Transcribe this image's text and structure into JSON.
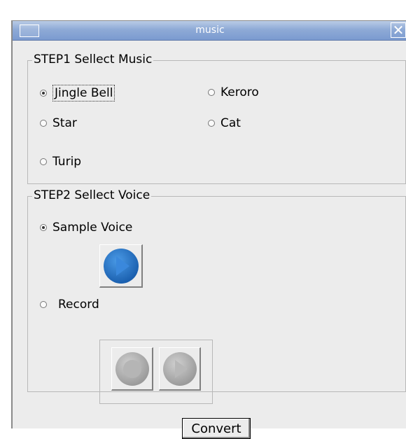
{
  "window": {
    "title": "music",
    "close_glyph": "✕"
  },
  "step1": {
    "title": "STEP1 Sellect Music",
    "options": [
      {
        "label": "Jingle Bell",
        "checked": true
      },
      {
        "label": "Keroro",
        "checked": false
      },
      {
        "label": "Star",
        "checked": false
      },
      {
        "label": "Cat",
        "checked": false
      },
      {
        "label": "Turip",
        "checked": false
      }
    ]
  },
  "step2": {
    "title": "STEP2 Sellect Voice",
    "sample_voice": {
      "label": "Sample Voice",
      "checked": true
    },
    "record": {
      "label": "Record",
      "checked": false
    }
  },
  "footer": {
    "convert_label": "Convert"
  },
  "colors": {
    "titlebar_top": "#b9cbe6",
    "titlebar_bottom": "#7b9bd0",
    "play_active": "#2a72c4",
    "disabled": "#b3b3b3"
  },
  "icons": {
    "sample_play": "play-icon",
    "record": "record-icon",
    "record_play": "play-icon"
  }
}
